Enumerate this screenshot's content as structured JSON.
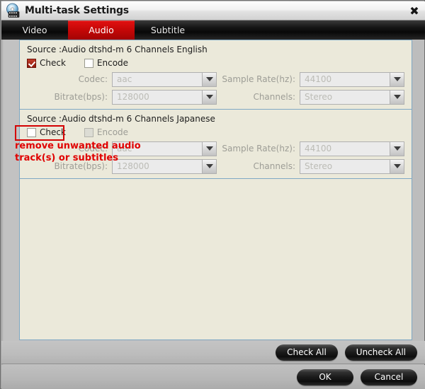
{
  "window": {
    "title": "Multi-task Settings",
    "icon": "disc-film-icon",
    "close_label": "✖"
  },
  "tabs": [
    {
      "label": "Video",
      "active": false
    },
    {
      "label": "Audio",
      "active": true
    },
    {
      "label": "Subtitle",
      "active": false
    }
  ],
  "tracks": [
    {
      "source_line": "Source :Audio  dtshd-m  6 Channels  English",
      "check": {
        "label": "Check",
        "checked": true,
        "disabled": false
      },
      "encode": {
        "label": "Encode",
        "checked": false,
        "disabled": false
      },
      "fields": {
        "codec": {
          "label": "Codec:",
          "value": "aac"
        },
        "sample_rate": {
          "label": "Sample Rate(hz):",
          "value": "44100"
        },
        "bitrate": {
          "label": "Bitrate(bps):",
          "value": "128000"
        },
        "channels": {
          "label": "Channels:",
          "value": "Stereo"
        }
      }
    },
    {
      "source_line": "Source :Audio  dtshd-m  6 Channels  Japanese",
      "check": {
        "label": "Check",
        "checked": false,
        "disabled": false
      },
      "encode": {
        "label": "Encode",
        "checked": false,
        "disabled": true
      },
      "fields": {
        "codec": {
          "label": "Codec:",
          "value": "aac"
        },
        "sample_rate": {
          "label": "Sample Rate(hz):",
          "value": "44100"
        },
        "bitrate": {
          "label": "Bitrate(bps):",
          "value": "128000"
        },
        "channels": {
          "label": "Channels:",
          "value": "Stereo"
        }
      }
    }
  ],
  "annotation": {
    "text": "remove unwanted audio\ntrack(s) or subtitles",
    "color": "#e00000",
    "box_color": "#d40000"
  },
  "buttons": {
    "check_all": "Check All",
    "uncheck_all": "Uncheck All",
    "ok": "OK",
    "cancel": "Cancel"
  },
  "colors": {
    "accent": "#c40707",
    "panel_bg": "#ebe9da",
    "panel_border": "#7fa8c4"
  }
}
